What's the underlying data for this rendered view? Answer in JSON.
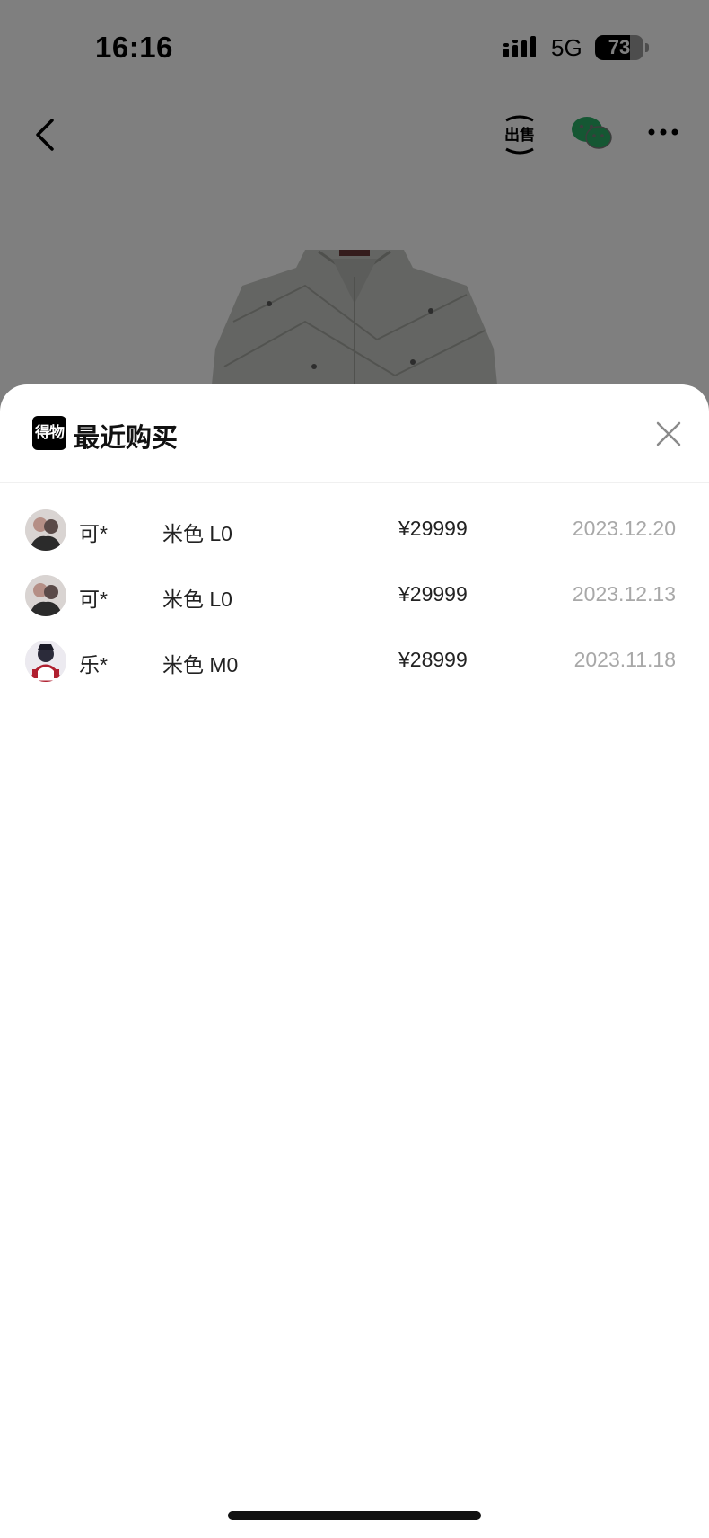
{
  "status_bar": {
    "time": "16:16",
    "network": "5G",
    "battery": "73",
    "battery_level": 0.73
  },
  "nav": {
    "back_icon": "chevron-left-icon",
    "sell_label": "出售",
    "wechat_icon": "wechat-icon",
    "more_icon": "more-horizontal-icon"
  },
  "sheet": {
    "logo_text": "得物",
    "title": "最近购买",
    "close_icon": "close-icon"
  },
  "purchases": [
    {
      "buyer": "可*",
      "spec": "米色 L0",
      "price": "¥29999",
      "date": "2023.12.20",
      "avatar": "avatar-photo"
    },
    {
      "buyer": "可*",
      "spec": "米色 L0",
      "price": "¥29999",
      "date": "2023.12.13",
      "avatar": "avatar-photo"
    },
    {
      "buyer": "乐*",
      "spec": "米色 M0",
      "price": "¥28999",
      "date": "2023.11.18",
      "avatar": "avatar-photo"
    }
  ],
  "colors": {
    "overlay": "#000000",
    "wechat_green": "#2aae67",
    "date_gray": "#a8a8a8"
  }
}
